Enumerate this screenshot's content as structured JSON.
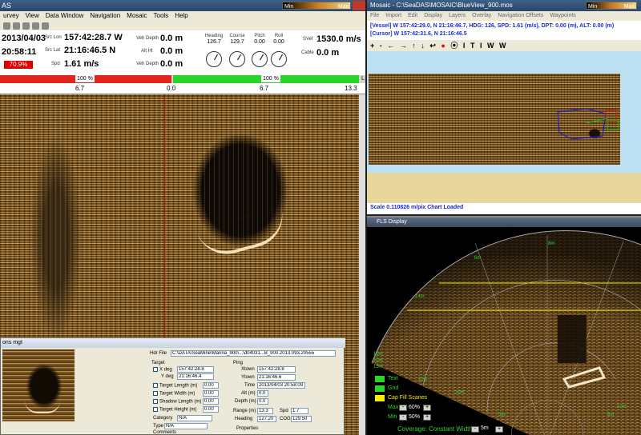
{
  "left": {
    "title": "AS",
    "minmax": {
      "min": "Min",
      "max": "Max"
    },
    "menu": [
      "urvey",
      "View",
      "Data Window",
      "Navigation",
      "Mosaic",
      "Tools",
      "Help"
    ],
    "status": {
      "date": "2013/04/03",
      "time": "20:58:11",
      "scroll_pct": "70.9%",
      "src_lon_label": "Src Lon",
      "src_lon": "157:42:28.7  W",
      "src_lat_label": "Src Lat",
      "src_lat": "21:16:46.5  N",
      "speed_label": "Spd",
      "speed": "1.61 m/s",
      "veh_depth_label": "Veh Depth",
      "veh_depth": "0.0 m",
      "alt_label": "Alt Ht",
      "alt": "0.0 m",
      "veh_depth2_label": "Veh Depth",
      "veh_depth2": "0.0 m",
      "heading_label": "Heading",
      "heading": "126.7",
      "course_label": "Course",
      "course": "129.7",
      "pitch_label": "Pitch",
      "pitch": "0.00",
      "roll_label": "Roll",
      "roll": "0.00",
      "svel_label": "SVel",
      "svel": "1530.0 m/s",
      "cable_label": "Cable",
      "cable": "0.0 m"
    },
    "gain": {
      "left_pct": "100 %",
      "right_pct": "100 %",
      "right_end": "L"
    },
    "scale_ticks": [
      "6.7",
      "0.0",
      "6.7",
      "13.3"
    ]
  },
  "dialog": {
    "title": "ons mgt",
    "file_label": "Hdr File",
    "file_path": "C:\\DATA\\SeaMine\\Marina_900\\...\\d04031...B_900.2013.093.20555",
    "target_label": "Target",
    "x_deg_label": "X deg",
    "x_deg": "157:42:28.8",
    "y_deg_label": "Y deg",
    "y_deg": "21:16:46.4",
    "length_label": "Target Length (m)",
    "length": "0.00",
    "width_label": "Target Width (m)",
    "width": "0.00",
    "shadow_label": "Shadow Length (m)",
    "shadow": "0.00",
    "height_label": "Target Height (m)",
    "height": "0.00",
    "category_label": "Category",
    "category": "N/A",
    "type_label": "Type",
    "type": "N/A",
    "comments_label": "Comments",
    "ping_label": "Ping",
    "xtown_label": "Xtown",
    "xtown": "157:42:28.8",
    "ytown_label": "Ytown",
    "ytown": "21:16:46.6",
    "time_label": "Time",
    "time": "2013/04/03 20:58:09",
    "alt_label": "Alt (m)",
    "alt": "0.0",
    "depth_label": "Depth (m)",
    "depth": "0.0",
    "range_label": "Range (m)",
    "range": "13.3",
    "spd_label": "Spd",
    "spd": "1.7",
    "heading_label": "Heading",
    "heading": "127.20",
    "cog_label": "COG",
    "cog": "129.50",
    "props_label": "Properties"
  },
  "mosaic": {
    "title": "Mosaic - C:\\SeaDAS\\MOSAIC\\BlueView_900.mos",
    "minmax": {
      "min": "Min",
      "max": "Max"
    },
    "menu": [
      "File",
      "Import",
      "Edit",
      "Display",
      "Layers",
      "Overlay",
      "Navigation Offsets",
      "Waypoints"
    ],
    "vessel_line": "[Vessel] W 157:42:29.0,  N 21:16:46.7, HDG: 126, SPD: 1.61 (m/s), DPT: 0.00 (m), ALT: 0.00 (m)",
    "cursor_line": "[Cursor] W 157:42:31.6,  N 21:16:46.5",
    "tools": [
      "+",
      "-",
      "←",
      "→",
      "↑",
      "↓",
      "↩",
      "●",
      "⦿",
      "I",
      "T",
      "I",
      "W",
      "W"
    ],
    "status": "Scale 0.110826 m/pix Chart Loaded"
  },
  "fan": {
    "title": "FLS Display",
    "range_labels": [
      "8m",
      "6m",
      "14m",
      "10m",
      "12m",
      "10m",
      "5m",
      "10m",
      "15m",
      "5m",
      "10m"
    ],
    "legend": [
      {
        "label": "Text",
        "color": "#2bd42b"
      },
      {
        "label": "Grid",
        "color": "#2bd42b"
      },
      {
        "label": "Cap Fill Scanes",
        "color": "#f4f000"
      }
    ],
    "max_label": "Max",
    "max_val": "60%",
    "min_label": "Min",
    "min_val": "50%",
    "coverage_label": "Coverage: Constant Width",
    "coverage_val": "5m"
  }
}
